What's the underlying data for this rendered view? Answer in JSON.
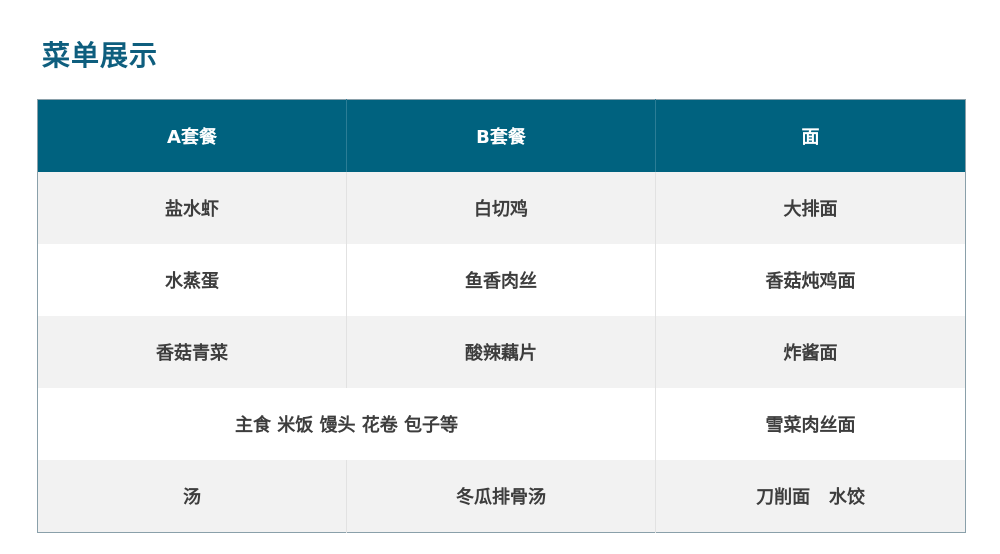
{
  "page": {
    "title": "菜单展示"
  },
  "colors": {
    "title": "#0e5e7e",
    "header_bg": "#00627f",
    "header_text": "#ffffff",
    "row_alt_bg": "#f2f2f2",
    "cell_text": "#3d3d3d"
  },
  "table": {
    "headers": [
      "A套餐",
      "B套餐",
      "面"
    ],
    "rows": [
      {
        "cells": [
          "盐水虾",
          "白切鸡",
          "大排面"
        ]
      },
      {
        "cells": [
          "水蒸蛋",
          "鱼香肉丝",
          "香菇炖鸡面"
        ]
      },
      {
        "cells": [
          "香菇青菜",
          "酸辣藕片",
          "炸酱面"
        ]
      },
      {
        "merged": "主食 米饭 馒头 花卷 包子等",
        "cells": [
          "雪菜肉丝面"
        ]
      },
      {
        "cells": [
          "汤",
          "冬瓜排骨汤",
          "刀削面   水饺"
        ]
      }
    ]
  }
}
